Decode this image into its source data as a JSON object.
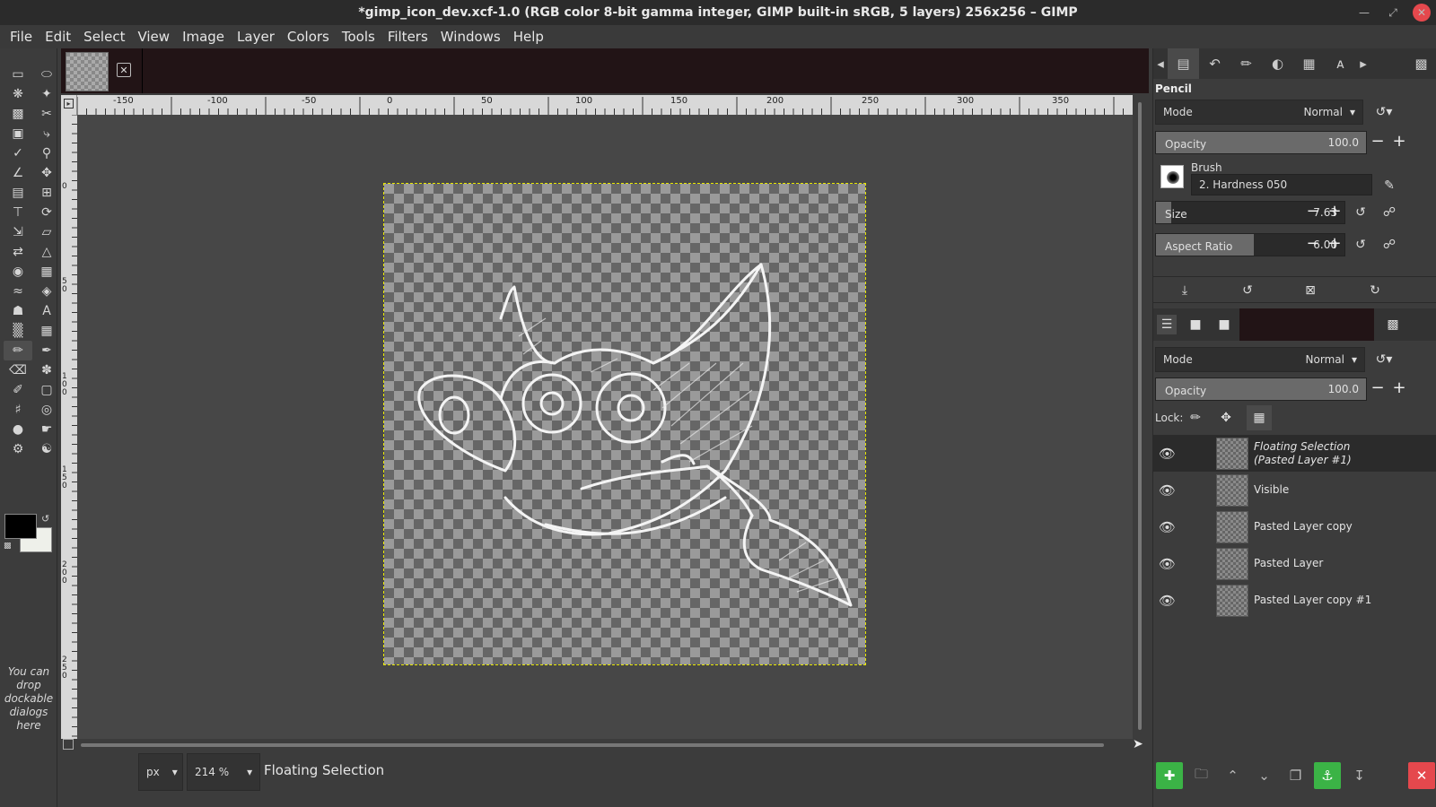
{
  "window": {
    "title": "*gimp_icon_dev.xcf-1.0 (RGB color 8-bit gamma integer, GIMP built-in sRGB, 5 layers) 256x256 – GIMP"
  },
  "menu": [
    "File",
    "Edit",
    "Select",
    "View",
    "Image",
    "Layer",
    "Colors",
    "Tools",
    "Filters",
    "Windows",
    "Help"
  ],
  "toolbox": {
    "drop_hint": "You can drop dockable dialogs here",
    "colors": {
      "foreground": "#000000",
      "background": "#eef0ea"
    },
    "tools": [
      "rect-select",
      "ellipse-select",
      "free-select",
      "fuzzy-select",
      "select-by-color",
      "scissors",
      "foreground-select",
      "paths",
      "color-picker",
      "zoom",
      "measure",
      "move",
      "align",
      "crop",
      "unified-transform",
      "rotate",
      "scale",
      "shear",
      "flip",
      "perspective",
      "3d-transform",
      "handle-transform",
      "warp-transform",
      "cage-transform",
      "text",
      "bucket-fill",
      "gradient",
      "pencil",
      "paintbrush",
      "eraser",
      "airbrush",
      "ink",
      "mypaint-brush",
      "clone",
      "heal",
      "smudge",
      "blur",
      "dodge-burn",
      "gegl",
      "paint-select"
    ]
  },
  "rulers": {
    "h_labels": [
      "-150",
      "-100",
      "-50",
      "0",
      "50",
      "100",
      "150",
      "200",
      "250",
      "300",
      "350"
    ],
    "v_labels": [
      "0",
      "50",
      "100",
      "150",
      "200",
      "250"
    ]
  },
  "status": {
    "unit": "px",
    "zoom": "214 %",
    "message": "Floating Selection"
  },
  "tool_options": {
    "tool_name": "Pencil",
    "mode_label": "Mode",
    "mode_value": "Normal",
    "opacity_label": "Opacity",
    "opacity_value": "100.0",
    "brush_label": "Brush",
    "brush_name": "2. Hardness 050",
    "size_label": "Size",
    "size_value": "7.63",
    "aspect_label": "Aspect Ratio",
    "aspect_value": "6.00"
  },
  "layers_panel": {
    "mode_label": "Mode",
    "mode_value": "Normal",
    "opacity_label": "Opacity",
    "opacity_value": "100.0",
    "lock_label": "Lock:",
    "layers": [
      {
        "name": "Floating Selection\n(Pasted Layer #1)",
        "visible": true,
        "selected": true
      },
      {
        "name": "Visible",
        "visible": true,
        "selected": false
      },
      {
        "name": "Pasted Layer copy",
        "visible": true,
        "selected": false
      },
      {
        "name": "Pasted Layer",
        "visible": true,
        "selected": false
      },
      {
        "name": "Pasted Layer copy #1",
        "visible": true,
        "selected": false
      }
    ]
  }
}
